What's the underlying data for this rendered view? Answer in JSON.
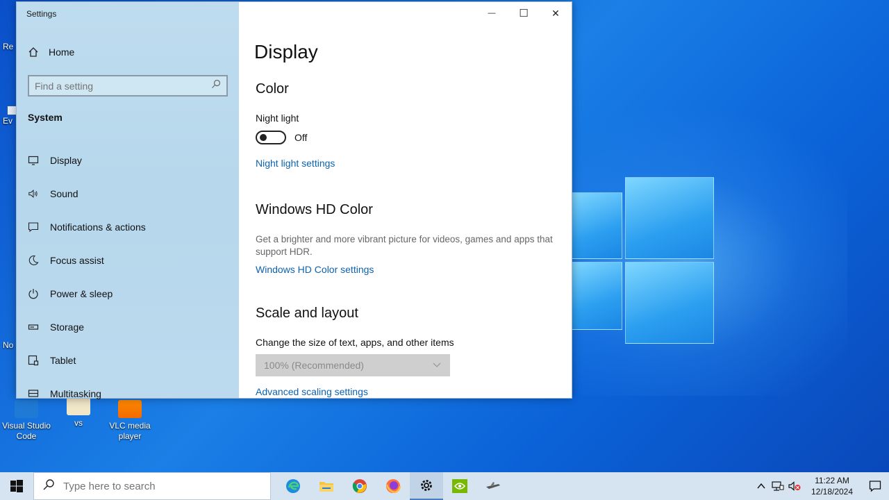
{
  "window": {
    "title": "Settings",
    "caption": {
      "minimize": "—",
      "maximize": "☐",
      "close": "✕"
    }
  },
  "sidebar": {
    "home_label": "Home",
    "search_placeholder": "Find a setting",
    "section_label": "System",
    "items": [
      {
        "label": "Display",
        "icon": "monitor-icon"
      },
      {
        "label": "Sound",
        "icon": "speaker-icon"
      },
      {
        "label": "Notifications & actions",
        "icon": "notification-icon"
      },
      {
        "label": "Focus assist",
        "icon": "moon-icon"
      },
      {
        "label": "Power & sleep",
        "icon": "power-icon"
      },
      {
        "label": "Storage",
        "icon": "storage-icon"
      },
      {
        "label": "Tablet",
        "icon": "tablet-icon"
      },
      {
        "label": "Multitasking",
        "icon": "multitasking-icon"
      }
    ]
  },
  "main": {
    "page_title": "Display",
    "color_heading": "Color",
    "night_light_label": "Night light",
    "night_light_state": "Off",
    "night_light_link": "Night light settings",
    "hd_heading": "Windows HD Color",
    "hd_description": "Get a brighter and more vibrant picture for videos, games and apps that support HDR.",
    "hd_link": "Windows HD Color settings",
    "scale_heading": "Scale and layout",
    "scale_label": "Change the size of text, apps, and other items",
    "scale_value": "100% (Recommended)",
    "scale_link": "Advanced scaling settings"
  },
  "desktop": {
    "shortcuts": [
      {
        "label": "Visual Studio Code"
      },
      {
        "label": "vs"
      },
      {
        "label": "VLC media player"
      }
    ],
    "edge_labels": [
      "Re",
      "Ev",
      "No"
    ]
  },
  "taskbar": {
    "search_placeholder": "Type here to search",
    "time": "11:22 AM",
    "date": "12/18/2024"
  },
  "colors": {
    "accent_link": "#0a62b0",
    "sidebar_bg": "#bcdaee",
    "desktop_blue": "#1a7fe6"
  }
}
